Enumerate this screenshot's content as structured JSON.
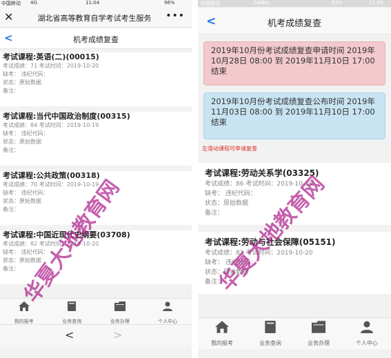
{
  "left": {
    "status": {
      "carrier": "中国移动",
      "network": "4G",
      "time": "11:04",
      "battery": "96%"
    },
    "wechat_title": "湖北省高等教育自学考试考生服务",
    "page_title": "机考成绩复查",
    "labels": {
      "score": "考试成绩：",
      "date": "考试时间：",
      "absent": "缺考：",
      "violation": "违纪代码：",
      "status": "状态：",
      "remark": "备注："
    },
    "records": [
      {
        "title": "考试课程:英语(二)(00015)",
        "score": "71",
        "date": "2019-10-20",
        "status": "原始数据"
      },
      {
        "title": "考试课程:当代中国政治制度(00315)",
        "score": "84",
        "date": "2019-10-19",
        "status": "原始数据"
      },
      {
        "title": "考试课程:公共政策(00318)",
        "score": "70",
        "date": "2019-10-19",
        "status": "原始数据"
      },
      {
        "title": "考试课程:中国近现代史纲要(03708)",
        "score": "82",
        "date": "2019-10-20",
        "status": "原始数据"
      }
    ],
    "tabs": [
      "我的报考",
      "业务查询",
      "业务办理",
      "个人中心"
    ],
    "watermark": "华夏大地教育网"
  },
  "right": {
    "status": {
      "carrier": "中国移动",
      "speed": "248B/s",
      "battery": "63%",
      "time": "11:09"
    },
    "page_title": "机考成绩复查",
    "notice_apply": "2019年10月份考试成绩复查申请时间 2019年10月28日 08:00 到 2019年11月10日 17:00 结束",
    "notice_publish": "2019年10月份考试成绩复查公布时间 2019年11月03日 08:00 到 2019年11月10日 17:00 结束",
    "hint": "左滑动课程可申请复查",
    "labels": {
      "score": "考试成绩：",
      "date": "考试时间：",
      "absent": "缺考：",
      "violation": "违纪代码：",
      "status": "状态：",
      "remark": "备注："
    },
    "records": [
      {
        "title": "考试课程:劳动关系学(03325)",
        "score": "86",
        "date": "2019-10-19",
        "status": "原始数据"
      },
      {
        "title": "考试课程:劳动与社会保障(05151)",
        "score": "83",
        "date": "2019-10-20",
        "status": "原始数据"
      }
    ],
    "tabs": [
      "我的报考",
      "业务查询",
      "业务办理",
      "个人中心"
    ],
    "watermark": "华夏大地教育网"
  },
  "colors": {
    "accent": "#1a73e8",
    "notice_red": "#f2c9cc",
    "notice_blue": "#c8e4f2",
    "hint": "#d93025",
    "watermark": "#b0238e"
  },
  "icons": {
    "tab_icons": [
      "home-icon",
      "book-icon",
      "folder-icon",
      "user-icon"
    ]
  }
}
